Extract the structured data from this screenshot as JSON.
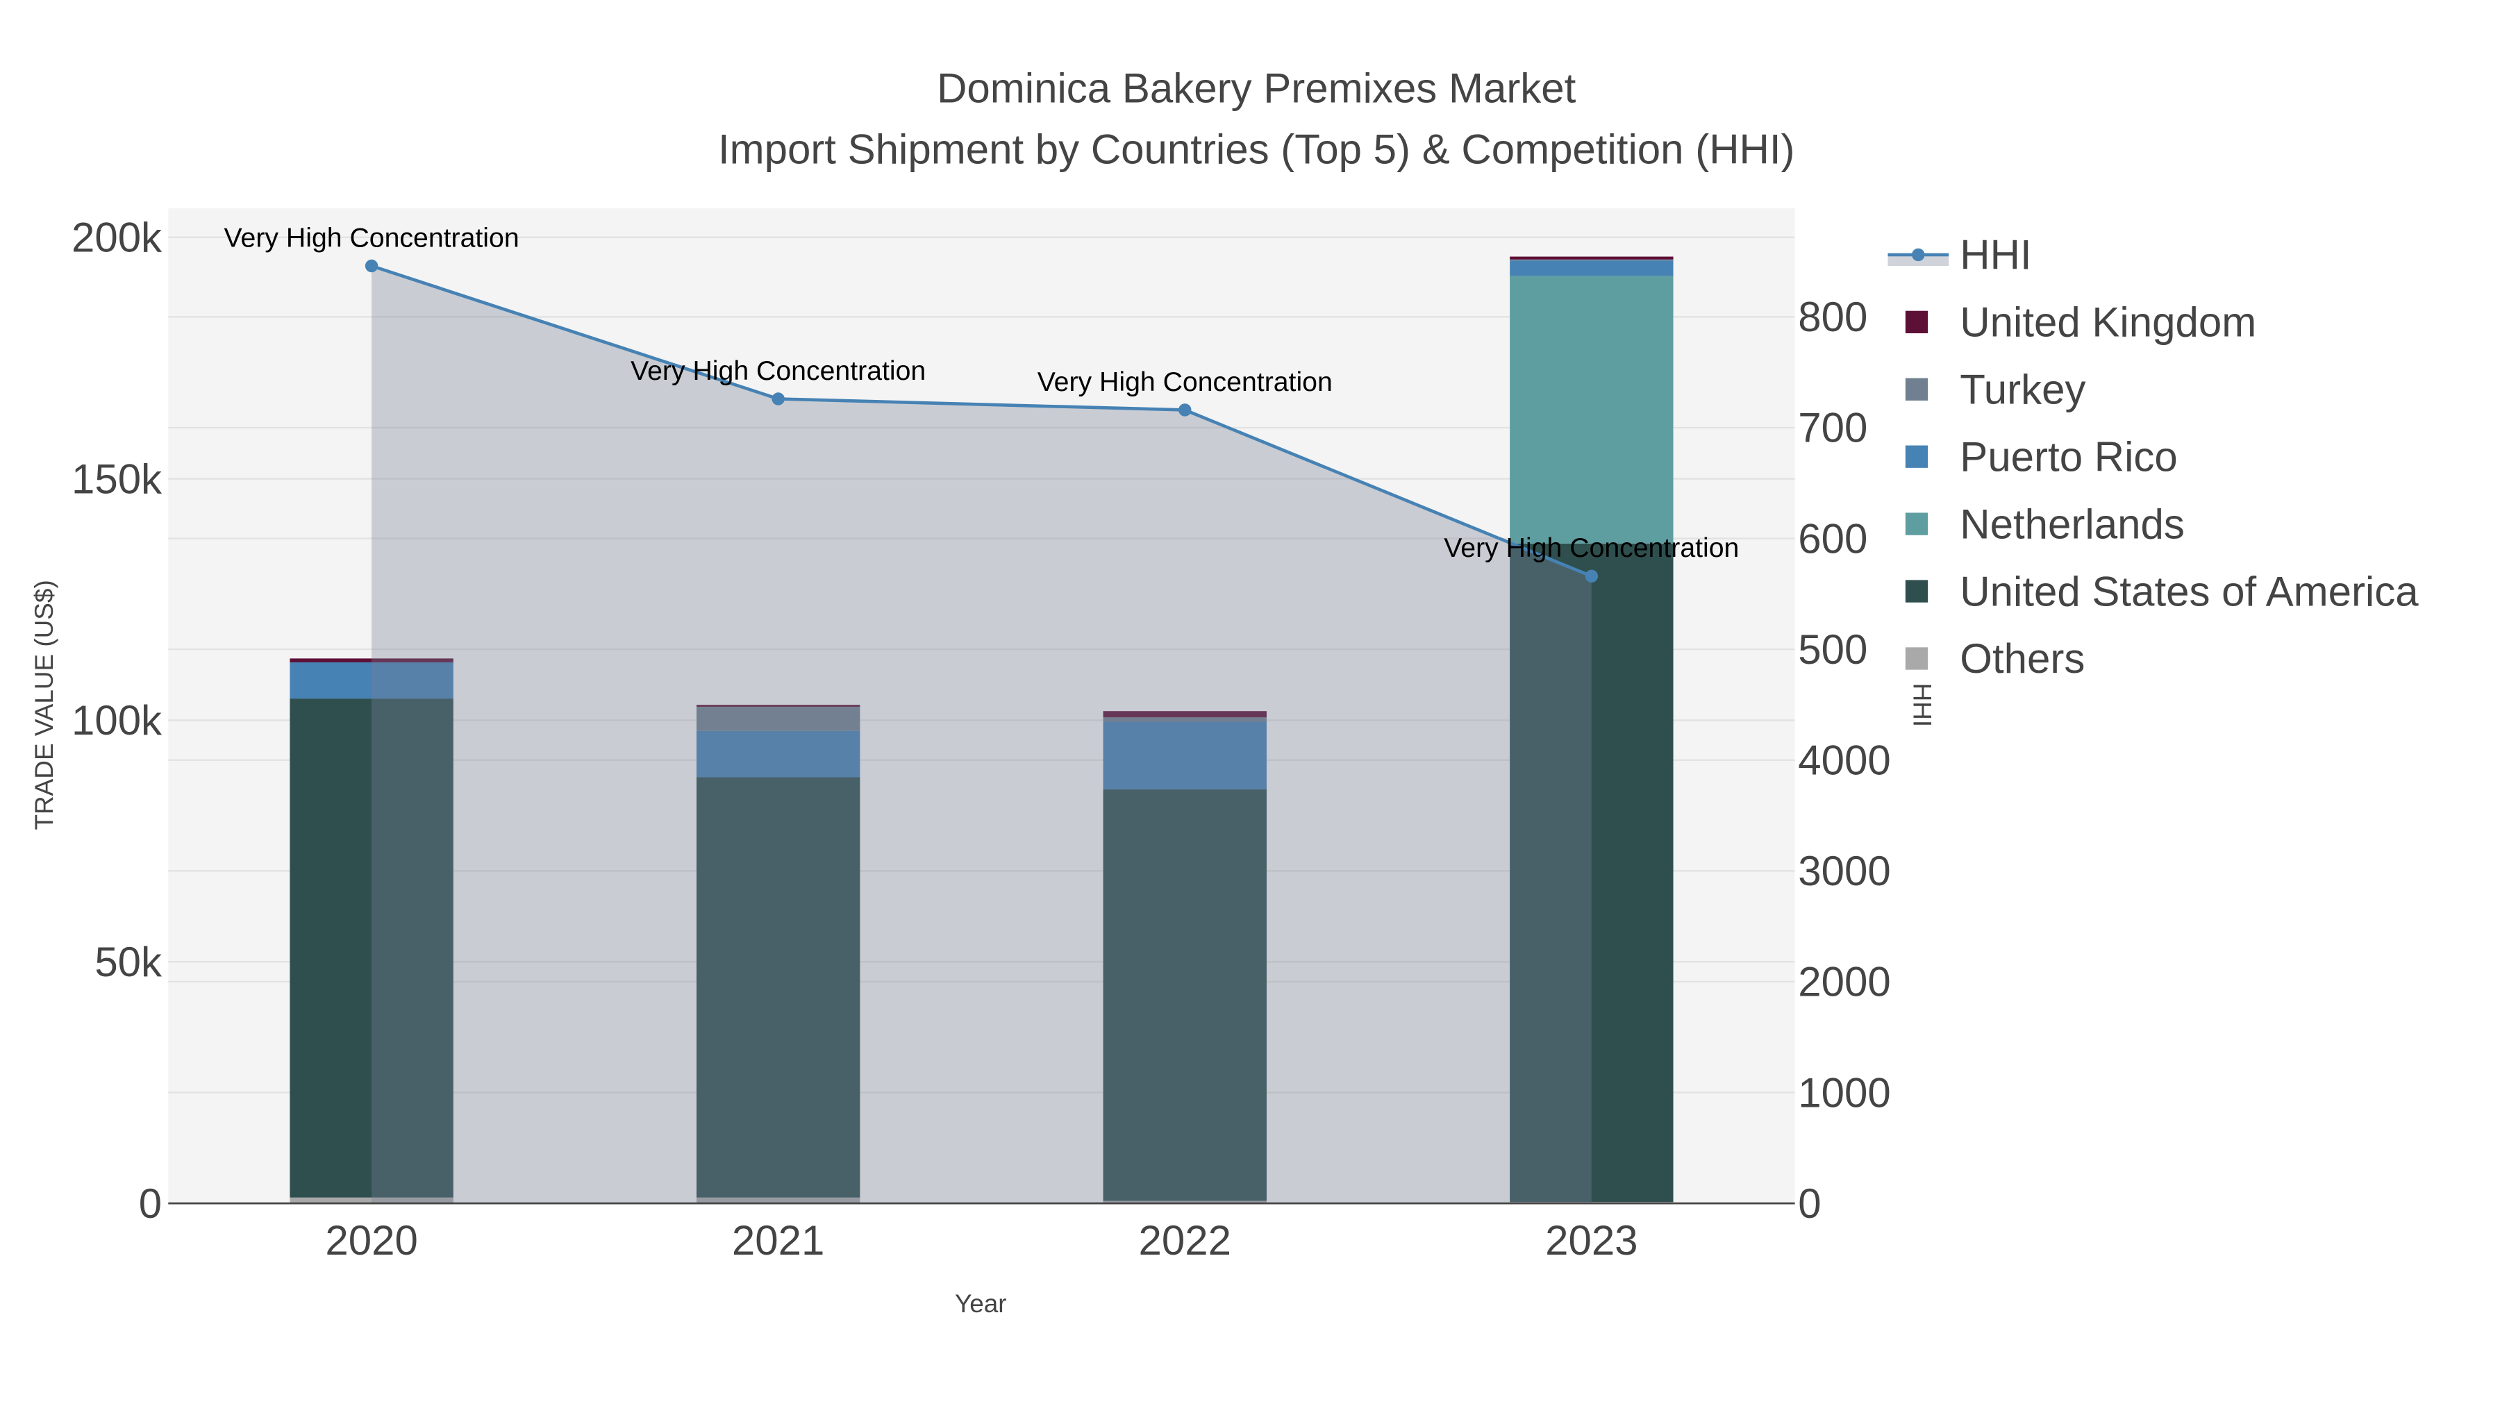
{
  "chart_data": {
    "type": "bar",
    "title": "Dominica Bakery Premixes Market",
    "subtitle": "Import Shipment by Countries (Top 5) & Competition (HHI)",
    "xlabel": "Year",
    "ylabel": "TRADE VALUE (US$)",
    "y2label": "HHI",
    "categories": [
      "2020",
      "2021",
      "2022",
      "2023"
    ],
    "ylim": [
      0,
      206000
    ],
    "y2lim": [
      0,
      898
    ],
    "y_ticks": [
      {
        "value": 0,
        "label": "0"
      },
      {
        "value": 50000,
        "label": "50k"
      },
      {
        "value": 100000,
        "label": "100k"
      },
      {
        "value": 150000,
        "label": "150k"
      },
      {
        "value": 200000,
        "label": "200k"
      }
    ],
    "y2_ticks": [
      {
        "value": 0,
        "label": "0"
      },
      {
        "value": 100,
        "label": "1000"
      },
      {
        "value": 200,
        "label": "2000"
      },
      {
        "value": 300,
        "label": "3000"
      },
      {
        "value": 400,
        "label": "4000"
      },
      {
        "value": 500,
        "label": "500"
      },
      {
        "value": 600,
        "label": "600"
      },
      {
        "value": 700,
        "label": "700"
      },
      {
        "value": 800,
        "label": "800"
      }
    ],
    "grid": true,
    "legend_position": "right",
    "stack_order": "bottom-to-top",
    "series": [
      {
        "name": "Others",
        "color": "#a9a9a9",
        "values": [
          1200,
          1200,
          500,
          300
        ]
      },
      {
        "name": "United States of America",
        "color": "#2f4f4f",
        "values": [
          103300,
          87000,
          85200,
          136300
        ]
      },
      {
        "name": "Netherlands",
        "color": "#5f9ea0",
        "values": [
          0,
          0,
          0,
          55400
        ]
      },
      {
        "name": "Puerto Rico",
        "color": "#4682b4",
        "values": [
          7500,
          9600,
          14000,
          3200
        ]
      },
      {
        "name": "Turkey",
        "color": "#708090",
        "values": [
          0,
          5000,
          900,
          200
        ]
      },
      {
        "name": "United Kingdom",
        "color": "#5d1035",
        "values": [
          800,
          400,
          1300,
          600
        ]
      }
    ],
    "hhi": {
      "name": "HHI",
      "color": "#4682b4",
      "fill": "rgba(120,130,150,0.35)",
      "values": [
        846,
        726,
        716,
        566
      ],
      "annotations": [
        "Very High Concentration",
        "Very High Concentration",
        "Very High Concentration",
        "Very High Concentration"
      ]
    },
    "legend": [
      "HHI",
      "United Kingdom",
      "Turkey",
      "Puerto Rico",
      "Netherlands",
      "United States of America",
      "Others"
    ]
  }
}
